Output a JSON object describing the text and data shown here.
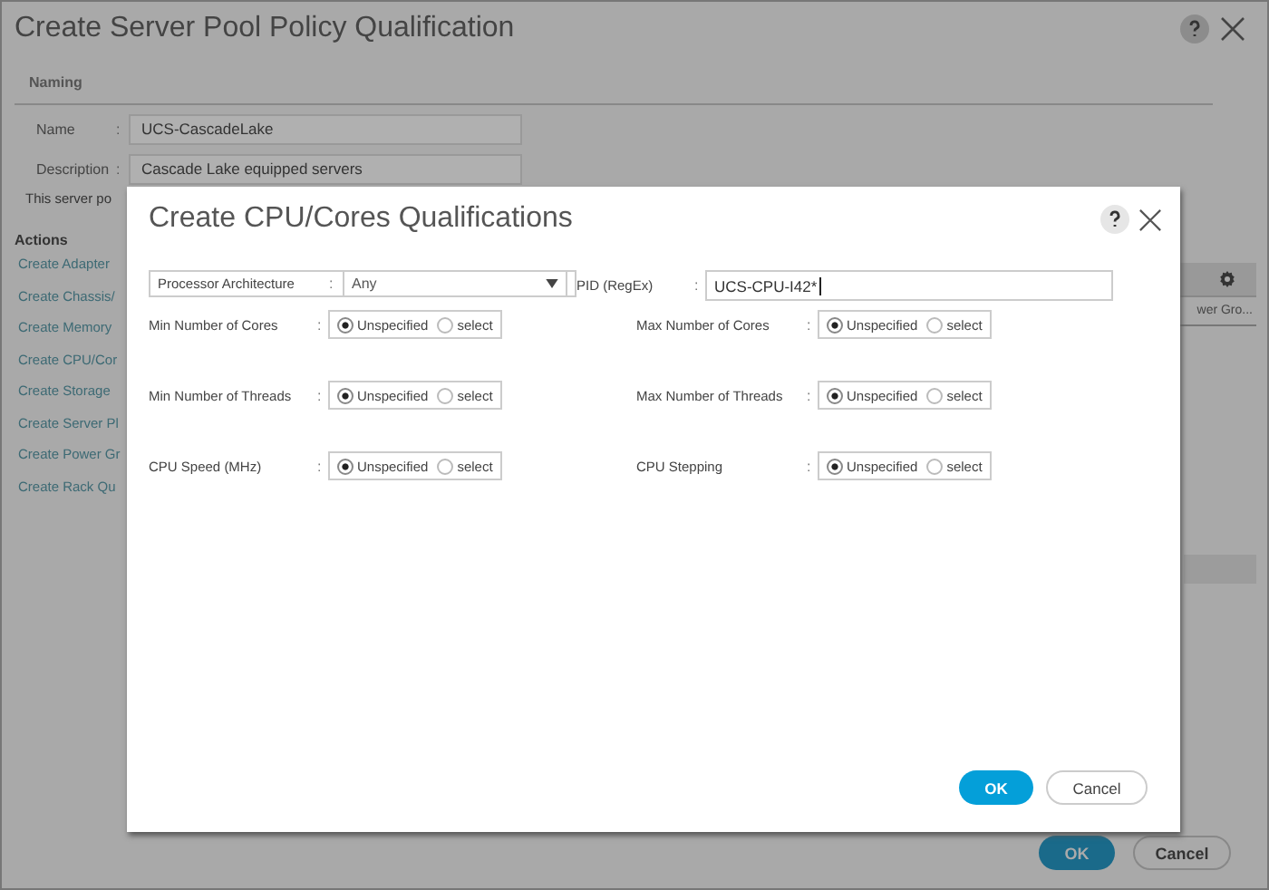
{
  "window": {
    "title": "Create Server Pool Policy Qualification"
  },
  "naming": {
    "heading": "Naming",
    "fields": [
      {
        "label": "Name",
        "separator": ":",
        "value": "UCS-CascadeLake"
      },
      {
        "label": "Description",
        "separator": ":",
        "value": "Cascade Lake equipped servers"
      }
    ],
    "note": "This server po"
  },
  "actions": {
    "heading": "Actions",
    "links": [
      "Create Adapter",
      "Create Chassis/",
      "Create Memory",
      "Create CPU/Cor",
      "Create Storage",
      "Create Server Pl",
      "Create Power Gr",
      "Create Rack Qu"
    ]
  },
  "table": {
    "cells": [
      "wer Gro..."
    ]
  },
  "buttons": [
    {
      "label": "OK",
      "kind": "primary"
    },
    {
      "label": "Cancel",
      "kind": "secondary"
    }
  ],
  "dialog": {
    "title": "Create CPU/Cores Qualifications",
    "rows": [
      {
        "left": {
          "kind": "select",
          "label": "Processor Architecture",
          "separator": ":",
          "value": "Any"
        },
        "right": {
          "kind": "text",
          "label": "PID (RegEx)",
          "separator": ":",
          "value": "UCS-CPU-I42*"
        }
      },
      {
        "left": {
          "kind": "radio",
          "label": "Min Number of Cores",
          "separator": ":",
          "options": [
            {
              "label": "Unspecified",
              "selected": true
            },
            {
              "label": "select",
              "selected": false
            }
          ]
        },
        "right": {
          "kind": "radio",
          "label": "Max Number of Cores",
          "separator": ":",
          "options": [
            {
              "label": "Unspecified",
              "selected": true
            },
            {
              "label": "select",
              "selected": false
            }
          ]
        }
      },
      {
        "left": {
          "kind": "radio",
          "label": "Min Number of Threads",
          "separator": ":",
          "options": [
            {
              "label": "Unspecified",
              "selected": true
            },
            {
              "label": "select",
              "selected": false
            }
          ]
        },
        "right": {
          "kind": "radio",
          "label": "Max Number of Threads",
          "separator": ":",
          "options": [
            {
              "label": "Unspecified",
              "selected": true
            },
            {
              "label": "select",
              "selected": false
            }
          ]
        }
      },
      {
        "left": {
          "kind": "radio",
          "label": "CPU Speed (MHz)",
          "separator": ":",
          "options": [
            {
              "label": "Unspecified",
              "selected": true
            },
            {
              "label": "select",
              "selected": false
            }
          ]
        },
        "right": {
          "kind": "radio",
          "label": "CPU Stepping",
          "separator": ":",
          "options": [
            {
              "label": "Unspecified",
              "selected": true
            },
            {
              "label": "select",
              "selected": false
            }
          ]
        }
      }
    ],
    "buttons": [
      {
        "label": "OK",
        "kind": "primary"
      },
      {
        "label": "Cancel",
        "kind": "secondary"
      }
    ]
  }
}
